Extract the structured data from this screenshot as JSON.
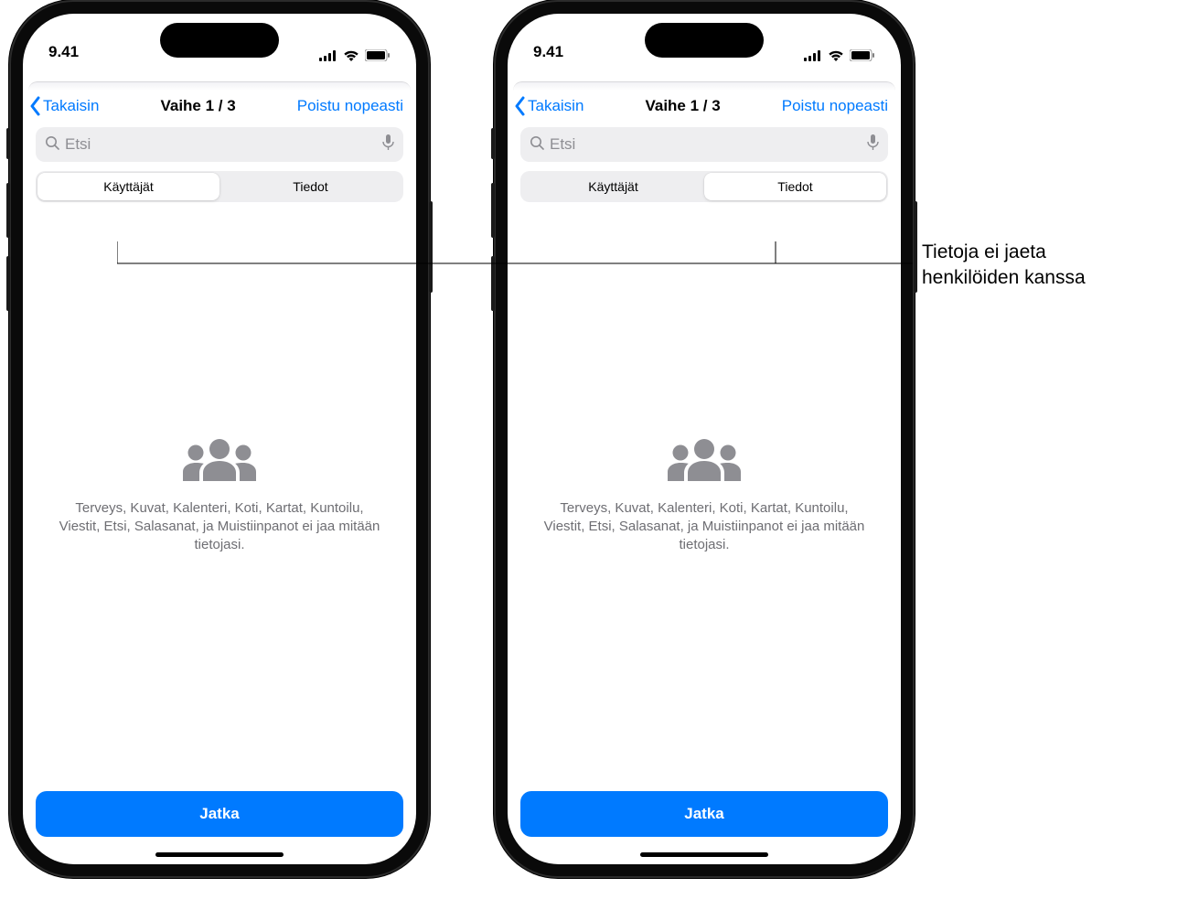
{
  "statusbar": {
    "time": "9.41"
  },
  "nav": {
    "back": "Takaisin",
    "title": "Vaihe 1 / 3",
    "exit": "Poistu nopeasti"
  },
  "search": {
    "placeholder": "Etsi"
  },
  "segments": {
    "users": "Käyttäjät",
    "data": "Tiedot"
  },
  "body": {
    "message": "Terveys, Kuvat, Kalenteri, Koti, Kartat, Kuntoilu, Viestit, Etsi, Salasanat, ja Muistiinpanot ei jaa mitään tietojasi."
  },
  "cta": {
    "label": "Jatka"
  },
  "annotation": {
    "line1": "Tietoja ei jaeta",
    "line2": "henkilöiden kanssa"
  }
}
